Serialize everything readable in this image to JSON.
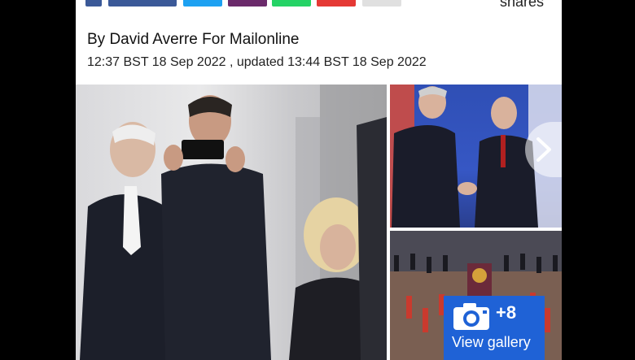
{
  "header": {
    "shares_label": "shares"
  },
  "article": {
    "byline": "By David Averre For Mailonline",
    "timestamp": "12:37 BST 18 Sep 2022 , updated 13:44 BST 18 Sep 2022"
  },
  "gallery": {
    "count": "+8",
    "label": "View gallery"
  },
  "colors": {
    "gallery_blue": "#1f62d6",
    "facebook": "#3b5998",
    "twitter": "#1da1f2",
    "pinterest": "#6b2a6b",
    "whatsapp": "#25d366",
    "email": "#e53935"
  },
  "icons": [
    "camera-icon",
    "chevron-right-icon"
  ]
}
